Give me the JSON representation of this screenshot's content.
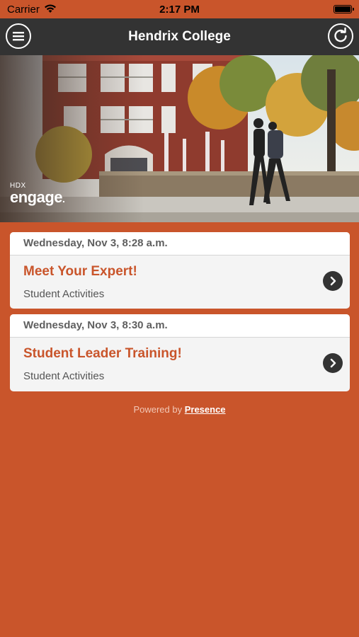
{
  "status_bar": {
    "carrier": "Carrier",
    "time": "2:17 PM",
    "icons": [
      "wifi-icon",
      "battery-icon"
    ]
  },
  "nav": {
    "title": "Hendrix College",
    "left_icon": "menu-icon",
    "right_icon": "refresh-icon"
  },
  "hero": {
    "brand_small": "HDX",
    "brand_big": "engage",
    "brand_dot": "."
  },
  "events": [
    {
      "date": "Wednesday, Nov 3, 8:28 a.m.",
      "title": "Meet Your Expert!",
      "organization": "Student Activities",
      "icon": "chevron-right-icon"
    },
    {
      "date": "Wednesday, Nov 3, 8:30 a.m.",
      "title": "Student Leader Training!",
      "organization": "Student Activities",
      "icon": "chevron-right-icon"
    }
  ],
  "footer": {
    "powered_by": "Powered by",
    "link": "Presence"
  },
  "colors": {
    "accent": "#c9552b",
    "nav_background": "#333333",
    "card_background": "#f4f4f4"
  }
}
